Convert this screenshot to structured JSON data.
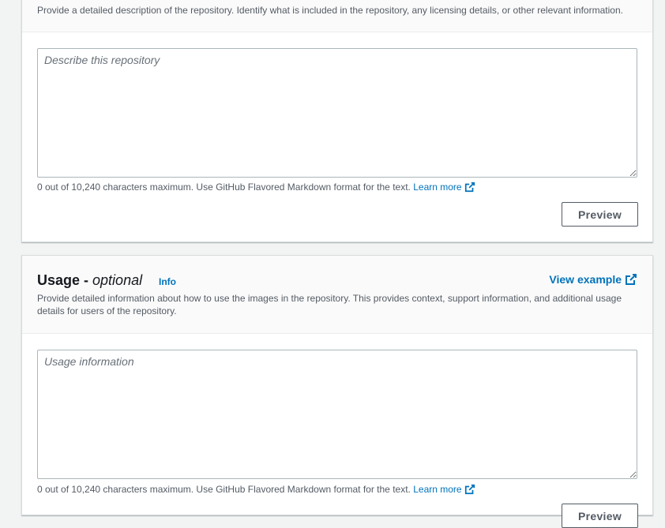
{
  "description_section": {
    "description": "Provide a detailed description of the repository. Identify what is included in the repository, any licensing details, or other relevant information.",
    "textarea_placeholder": "Describe this repository",
    "hint": "0 out of 10,240 characters maximum. Use GitHub Flavored Markdown format for the text.",
    "learn_more": "Learn more",
    "preview_label": "Preview"
  },
  "usage_section": {
    "title": "Usage - ",
    "title_optional": "optional",
    "info_label": "Info",
    "view_example": "View example",
    "description": "Provide detailed information about how to use the images in the repository. This provides context, support information, and additional usage details for users of the repository.",
    "textarea_placeholder": "Usage information",
    "hint": "0 out of 10,240 characters maximum. Use GitHub Flavored Markdown format for the text.",
    "learn_more": "Learn more",
    "preview_label": "Preview"
  },
  "icons": {
    "external_link": "external-link-icon",
    "resize": "resize-grip-icon"
  },
  "colors": {
    "link": "#0073bb",
    "page_bg": "#f2f3f3",
    "panel_border": "#d5dbdb"
  }
}
